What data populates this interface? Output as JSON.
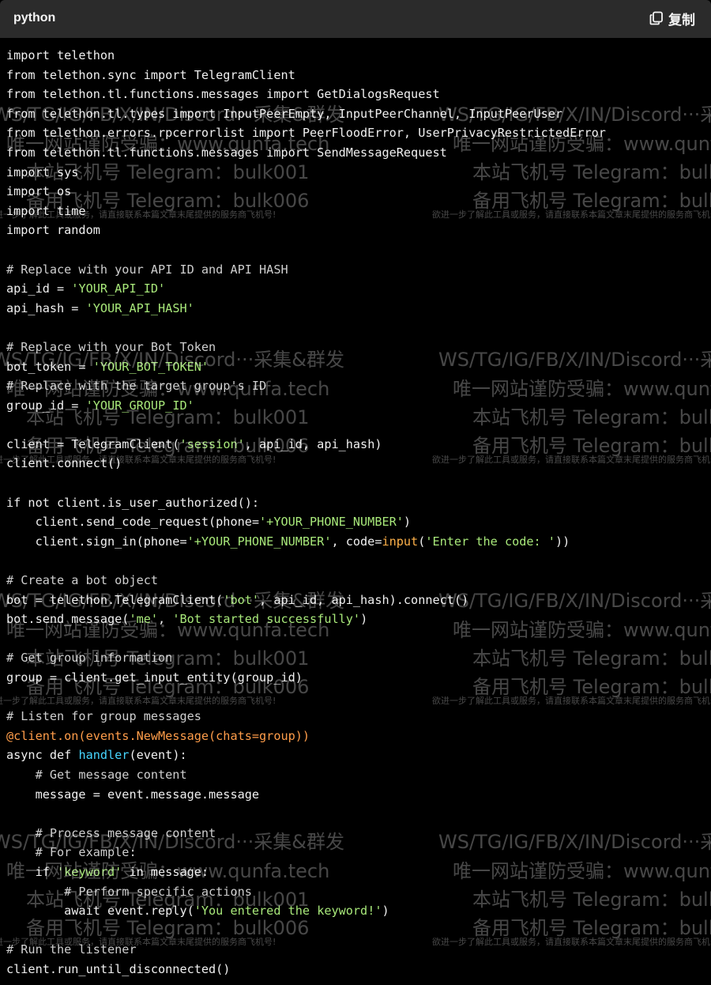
{
  "header": {
    "language": "python",
    "copy_label": "复制"
  },
  "colors": {
    "background": "#000000",
    "header": "#2b2b2b",
    "string": "#a8e87a",
    "decorator": "#ff9d4a",
    "function": "#47d6ff"
  },
  "code_lines": [
    [
      [
        "import telethon",
        ""
      ]
    ],
    [
      [
        "from telethon.sync import TelegramClient",
        ""
      ]
    ],
    [
      [
        "from telethon.tl.functions.messages import GetDialogsRequest",
        ""
      ]
    ],
    [
      [
        "from telethon.tl.types import InputPeerEmpty, InputPeerChannel, InputPeerUser",
        ""
      ]
    ],
    [
      [
        "from telethon.errors.rpcerrorlist import PeerFloodError, UserPrivacyRestrictedError",
        ""
      ]
    ],
    [
      [
        "from telethon.tl.functions.messages import SendMessageRequest",
        ""
      ]
    ],
    [
      [
        "import sys",
        ""
      ]
    ],
    [
      [
        "import os",
        ""
      ]
    ],
    [
      [
        "import time",
        ""
      ]
    ],
    [
      [
        "import random",
        ""
      ]
    ],
    [],
    [
      [
        "# Replace with your API ID and API HASH",
        "cm"
      ]
    ],
    [
      [
        "api_id = ",
        ""
      ],
      [
        "'YOUR_API_ID'",
        "str"
      ]
    ],
    [
      [
        "api_hash = ",
        ""
      ],
      [
        "'YOUR_API_HASH'",
        "str"
      ]
    ],
    [],
    [
      [
        "# Replace with your Bot Token",
        "cm"
      ]
    ],
    [
      [
        "bot_token = ",
        ""
      ],
      [
        "'YOUR_BOT_TOKEN'",
        "str"
      ]
    ],
    [
      [
        "# Replace with the target group's ID",
        "cm"
      ]
    ],
    [
      [
        "group_id = ",
        ""
      ],
      [
        "'YOUR_GROUP_ID'",
        "str"
      ]
    ],
    [],
    [
      [
        "client = TelegramClient(",
        ""
      ],
      [
        "'session'",
        "str"
      ],
      [
        ", api_id, api_hash)",
        ""
      ]
    ],
    [
      [
        "client.connect()",
        ""
      ]
    ],
    [],
    [
      [
        "if not client.is_user_authorized():",
        ""
      ]
    ],
    [
      [
        "    client.send_code_request(phone=",
        ""
      ],
      [
        "'+YOUR_PHONE_NUMBER'",
        "str"
      ],
      [
        ")",
        ""
      ]
    ],
    [
      [
        "    client.sign_in(phone=",
        ""
      ],
      [
        "'+YOUR_PHONE_NUMBER'",
        "str"
      ],
      [
        ", code=",
        ""
      ],
      [
        "input",
        "bi"
      ],
      [
        "(",
        ""
      ],
      [
        "'Enter the code: '",
        "str"
      ],
      [
        "))",
        ""
      ]
    ],
    [],
    [
      [
        "# Create a bot object",
        "cm"
      ]
    ],
    [
      [
        "bot = telethon.TelegramClient(",
        ""
      ],
      [
        "'bot'",
        "str"
      ],
      [
        ", api_id, api_hash).connect()",
        ""
      ]
    ],
    [
      [
        "bot.send_message(",
        ""
      ],
      [
        "'me'",
        "str"
      ],
      [
        ", ",
        ""
      ],
      [
        "'Bot started successfully'",
        "str"
      ],
      [
        ")",
        ""
      ]
    ],
    [],
    [
      [
        "# Get group information",
        "cm"
      ]
    ],
    [
      [
        "group = client.get_input_entity(group_id)",
        ""
      ]
    ],
    [],
    [
      [
        "# Listen for group messages",
        "cm"
      ]
    ],
    [
      [
        "@client.on(events.NewMessage(chats=group))",
        "dec"
      ]
    ],
    [
      [
        "async def ",
        ""
      ],
      [
        "handler",
        "fn"
      ],
      [
        "(event):",
        ""
      ]
    ],
    [
      [
        "    # Get message content",
        "cm"
      ]
    ],
    [
      [
        "    message = event.message.message",
        ""
      ]
    ],
    [],
    [
      [
        "    # Process message content",
        "cm"
      ]
    ],
    [
      [
        "    # For example:",
        "cm"
      ]
    ],
    [
      [
        "    if ",
        ""
      ],
      [
        "'keyword'",
        "str"
      ],
      [
        " in message:",
        ""
      ]
    ],
    [
      [
        "        # Perform specific actions",
        "cm"
      ]
    ],
    [
      [
        "        await event.reply(",
        ""
      ],
      [
        "'You entered the keyword!'",
        "str"
      ],
      [
        ")",
        ""
      ]
    ],
    [],
    [
      [
        "# Run the listener",
        "cm"
      ]
    ],
    [
      [
        "client.run_until_disconnected()",
        ""
      ]
    ]
  ],
  "watermarks": {
    "line_a": "WS/TG/IG/FB/X/IN/Discord···采集&群发",
    "line_b": "唯一网站谨防受骗：www.qunfa.tech",
    "line_c": "本站飞机号 Telegram：bulk001",
    "line_d": "备用飞机号 Telegram：bulk006",
    "line_e": "欲进一步了解此工具或服务，请直接联系本篇文章末尾提供的服务商飞机号!"
  }
}
